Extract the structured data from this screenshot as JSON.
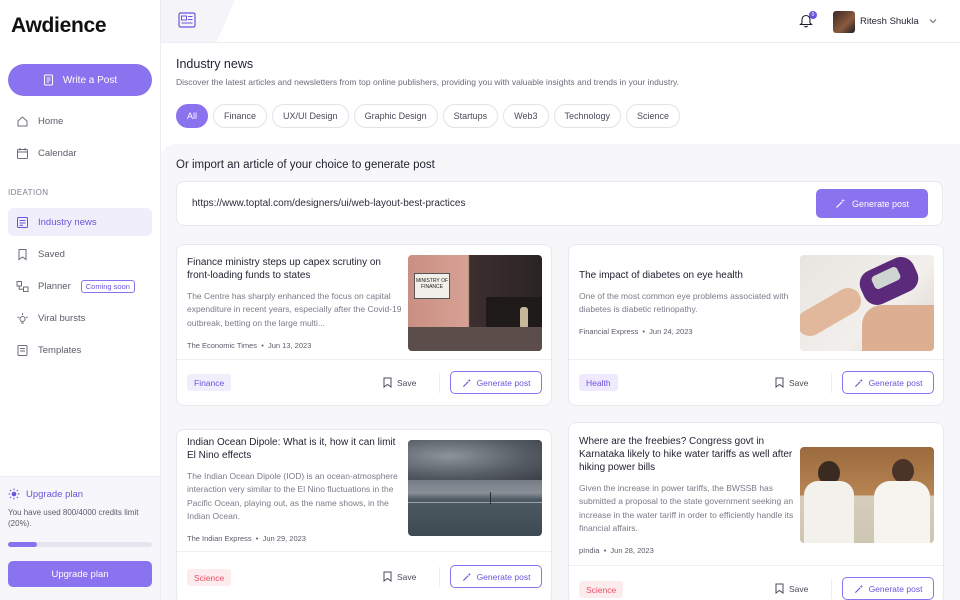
{
  "app": {
    "logo": "Awdience"
  },
  "sidebar": {
    "write_label": "Write a Post",
    "items": [
      {
        "label": "Home",
        "icon": "home-icon"
      },
      {
        "label": "Calendar",
        "icon": "calendar-icon"
      }
    ],
    "section_label": "IDEATION",
    "ideation_items": [
      {
        "label": "Industry news",
        "icon": "news-icon",
        "active": true
      },
      {
        "label": "Saved",
        "icon": "bookmark-icon"
      },
      {
        "label": "Planner",
        "icon": "planner-icon",
        "badge": "Coming soon"
      },
      {
        "label": "Viral bursts",
        "icon": "sparkle-icon"
      },
      {
        "label": "Templates",
        "icon": "template-icon"
      }
    ],
    "upgrade": {
      "title": "Upgrade plan",
      "text": "You have used 800/4000 credits limit (20%).",
      "progress": 0.2,
      "button_label": "Upgrade plan"
    }
  },
  "topbar": {
    "notification_count": "0",
    "user_name": "Ritesh Shukla"
  },
  "page": {
    "title": "Industry news",
    "subtitle": "Discover the latest articles and newsletters from top online publishers, providing you with valuable insights and trends in your industry.",
    "filters": [
      "All",
      "Finance",
      "UX/UI Design",
      "Graphic Design",
      "Startups",
      "Web3",
      "Technology",
      "Science"
    ],
    "active_filter": "All"
  },
  "import": {
    "label": "Or import an article of your choice to generate post",
    "url": "https://www.toptal.com/designers/ui/web-layout-best-practices",
    "button_label": "Generate post"
  },
  "articles": [
    {
      "title": "Finance ministry steps up capex scrutiny on front-loading funds to states",
      "desc": "The Centre has sharply enhanced the focus on capital expenditure in recent years, especially after the Covid-19 outbreak, betting on the large multi...",
      "source": "The Economic Times",
      "date": "Jun 13, 2023",
      "tag": "Finance",
      "save_label": "Save",
      "gen_label": "Generate post",
      "image_sign": "MINISTRY OF FINANCE"
    },
    {
      "title": "The impact of diabetes on eye health",
      "desc": "One of the most common eye problems associated with diabetes is diabetic retinopathy.",
      "source": "Financial Express",
      "date": "Jun 24, 2023",
      "tag": "Health",
      "save_label": "Save",
      "gen_label": "Generate post"
    },
    {
      "title": "Indian Ocean Dipole: What is it, how it can limit El Nino effects",
      "desc": "The Indian Ocean Dipole (IOD) is an ocean-atmosphere interaction very similar to the El Nino fluctuations in the Pacific Ocean, playing out, as the name shows, in the Indian Ocean.",
      "source": "The Indian Express",
      "date": "Jun 29, 2023",
      "tag": "Science",
      "save_label": "Save",
      "gen_label": "Generate post"
    },
    {
      "title": "Where are the freebies? Congress govt in Karnataka likely to hike water tariffs as well after hiking power bills",
      "desc": "Given the increase in power tariffs, the BWSSB has submitted a proposal to the state government seeking an increase in the water tariff in order to efficiently handle its financial affairs.",
      "source": "pIndia",
      "date": "Jun 28, 2023",
      "tag": "Science",
      "save_label": "Save",
      "gen_label": "Generate post"
    }
  ],
  "colors": {
    "accent": "#8a73ee",
    "accent_dark": "#6b54dd",
    "tag_finance_bg": "#f1eefc",
    "tag_health_bg": "#efe9fd",
    "tag_science_bg": "#fdecee",
    "tag_science_fg": "#e8506a"
  }
}
